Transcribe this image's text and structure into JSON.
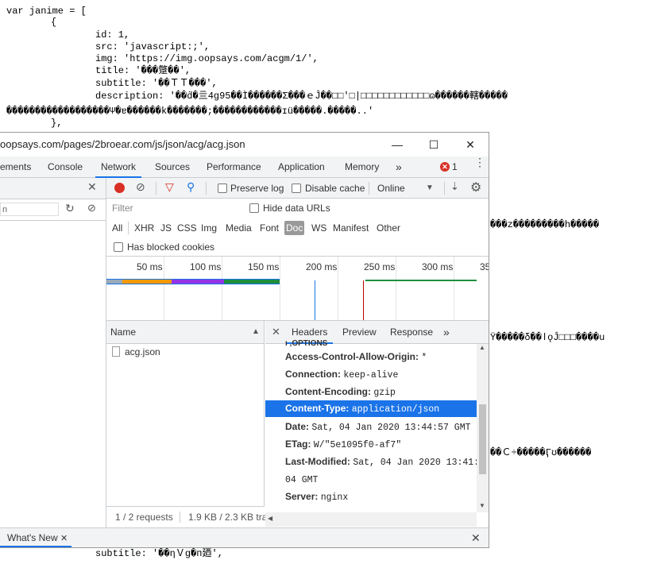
{
  "code": {
    "l1": "var janime = [",
    "l2": "{",
    "l3": "id: 1,",
    "l4": "src: 'javascript:;',",
    "l5": "img: 'https://img.oopsays.com/acgm/1/',",
    "l6": "title: '���蹩��',",
    "l7": "subtitle: '��ＴＴ���',",
    "l8": "description: '��ḋ�亖4g95��Ì������Σ���ｅĴ��□□'□|□□□□□□□□□□□□ɷ������轄�����",
    "l9": "������������������Ψ�ɐ������k�������;������������ɪü�����.�����..'",
    "l10": "},",
    "r1": "���z���������h�����",
    "r2": "Ÿ�����δ��ǀǫĴ□□□����u",
    "r3": "��Ｃ÷�����Ӷʊ������",
    "bottom": "subtitle: '��ηＶg�п廼',"
  },
  "window": {
    "title": "oopsays.com/pages/2broear.com/js/json/acg/acg.json",
    "minimize": "—",
    "maximize": "☐",
    "close": "✕"
  },
  "tabs": [
    "ements",
    "Console",
    "Network",
    "Sources",
    "Performance",
    "Application",
    "Memory"
  ],
  "more_tabs": "»",
  "errors": "1",
  "toolbar": {
    "preserve_log": "Preserve log",
    "disable_cache": "Disable cache",
    "throttle": "Online",
    "filter_placeholder": "Filter",
    "hide_data_urls": "Hide data URLs",
    "has_blocked": "Has blocked cookies"
  },
  "left": {
    "input": "n"
  },
  "types": [
    "All",
    "XHR",
    "JS",
    "CSS",
    "Img",
    "Media",
    "Font",
    "Doc",
    "WS",
    "Manifest",
    "Other"
  ],
  "timeline_ticks": [
    "50 ms",
    "100 ms",
    "150 ms",
    "200 ms",
    "250 ms",
    "300 ms",
    "35"
  ],
  "name_header": "Name",
  "file": "acg.json",
  "detail_tabs": [
    "Headers",
    "Preview",
    "Response"
  ],
  "headers": [
    {
      "k": "ı ,OPTIONS",
      "v": ""
    },
    {
      "k": "Access-Control-Allow-Origin:",
      "v": "*"
    },
    {
      "k": "Connection:",
      "v": "keep-alive"
    },
    {
      "k": "Content-Encoding:",
      "v": "gzip"
    },
    {
      "k": "Content-Type:",
      "v": "application/json"
    },
    {
      "k": "Date:",
      "v": "Sat, 04 Jan 2020 13:44:57 GMT"
    },
    {
      "k": "ETag:",
      "v": "W/\"5e1095f0-af7\""
    },
    {
      "k": "Last-Modified:",
      "v": "Sat, 04 Jan 2020 13:41:"
    },
    {
      "k": "",
      "v": "04 GMT"
    },
    {
      "k": "Server:",
      "v": "nginx"
    }
  ],
  "status": {
    "requests": "1 / 2 requests",
    "size": "1.9 KB / 2.3 KB tra"
  },
  "drawer": {
    "tab": "What's New",
    "close": "✕"
  },
  "colors": {
    "accent": "#1a73e8",
    "record": "#d93025"
  }
}
